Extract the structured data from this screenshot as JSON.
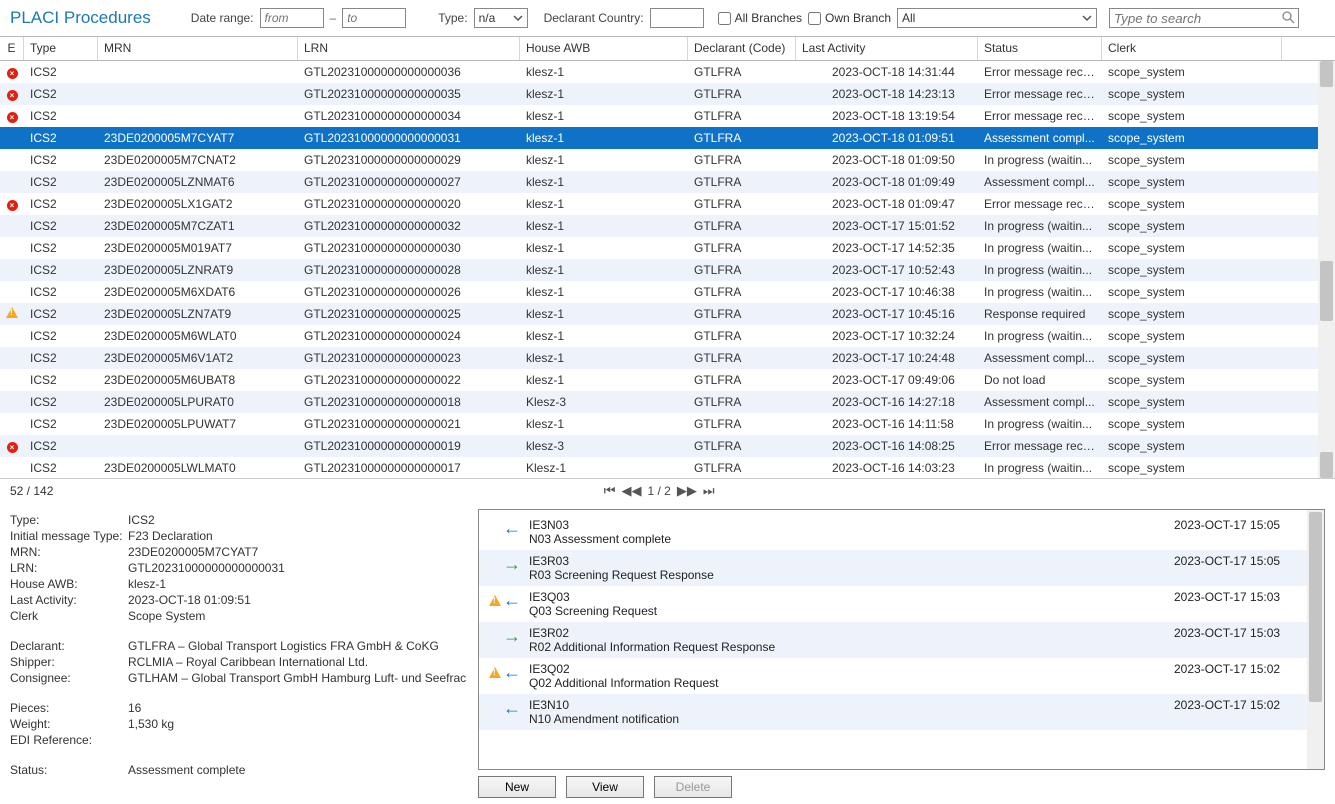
{
  "toolbar": {
    "title": "PLACI Procedures",
    "date_range_label": "Date range:",
    "from_ph": "from",
    "to_ph": "to",
    "sep": "–",
    "type_label": "Type:",
    "type_value": "n/a",
    "decl_country_label": "Declarant Country:",
    "all_branches_label": "All Branches",
    "own_branch_label": "Own Branch",
    "branch_value": "All",
    "search_ph": "Type to search"
  },
  "columns": {
    "e": "E",
    "type": "Type",
    "mrn": "MRN",
    "lrn": "LRN",
    "hawb": "House AWB",
    "decl": "Declarant (Code)",
    "act": "Last Activity",
    "stat": "Status",
    "clerk": "Clerk"
  },
  "rows": [
    {
      "e": "err",
      "type": "ICS2",
      "mrn": "",
      "lrn": "GTL20231000000000000036",
      "hawb": "klesz-1",
      "decl": "GTLFRA",
      "act": "2023-OCT-18 14:31:44",
      "stat": "Error message recei...",
      "clerk": "scope_system"
    },
    {
      "e": "err",
      "type": "ICS2",
      "mrn": "",
      "lrn": "GTL20231000000000000035",
      "hawb": "klesz-1",
      "decl": "GTLFRA",
      "act": "2023-OCT-18 14:23:13",
      "stat": "Error message recei...",
      "clerk": "scope_system"
    },
    {
      "e": "err",
      "type": "ICS2",
      "mrn": "",
      "lrn": "GTL20231000000000000034",
      "hawb": "klesz-1",
      "decl": "GTLFRA",
      "act": "2023-OCT-18 13:19:54",
      "stat": "Error message recei...",
      "clerk": "scope_system"
    },
    {
      "e": "",
      "type": "ICS2",
      "mrn": "23DE0200005M7CYAT7",
      "lrn": "GTL20231000000000000031",
      "hawb": "klesz-1",
      "decl": "GTLFRA",
      "act": "2023-OCT-18 01:09:51",
      "stat": "Assessment compl...",
      "clerk": "scope_system",
      "selected": true
    },
    {
      "e": "",
      "type": "ICS2",
      "mrn": "23DE0200005M7CNAT2",
      "lrn": "GTL20231000000000000029",
      "hawb": "klesz-1",
      "decl": "GTLFRA",
      "act": "2023-OCT-18 01:09:50",
      "stat": "In progress (waitin...",
      "clerk": "scope_system"
    },
    {
      "e": "",
      "type": "ICS2",
      "mrn": "23DE0200005LZNMAT6",
      "lrn": "GTL20231000000000000027",
      "hawb": "klesz-1",
      "decl": "GTLFRA",
      "act": "2023-OCT-18 01:09:49",
      "stat": "Assessment compl...",
      "clerk": "scope_system"
    },
    {
      "e": "err",
      "type": "ICS2",
      "mrn": "23DE0200005LX1GAT2",
      "lrn": "GTL20231000000000000020",
      "hawb": "klesz-1",
      "decl": "GTLFRA",
      "act": "2023-OCT-18 01:09:47",
      "stat": "Error message recei...",
      "clerk": "scope_system"
    },
    {
      "e": "",
      "type": "ICS2",
      "mrn": "23DE0200005M7CZAT1",
      "lrn": "GTL20231000000000000032",
      "hawb": "klesz-1",
      "decl": "GTLFRA",
      "act": "2023-OCT-17 15:01:52",
      "stat": "In progress (waitin...",
      "clerk": "scope_system"
    },
    {
      "e": "",
      "type": "ICS2",
      "mrn": "23DE0200005M019AT7",
      "lrn": "GTL20231000000000000030",
      "hawb": "klesz-1",
      "decl": "GTLFRA",
      "act": "2023-OCT-17 14:52:35",
      "stat": "In progress (waitin...",
      "clerk": "scope_system"
    },
    {
      "e": "",
      "type": "ICS2",
      "mrn": "23DE0200005LZNRAT9",
      "lrn": "GTL20231000000000000028",
      "hawb": "klesz-1",
      "decl": "GTLFRA",
      "act": "2023-OCT-17 10:52:43",
      "stat": "In progress (waitin...",
      "clerk": "scope_system"
    },
    {
      "e": "",
      "type": "ICS2",
      "mrn": "23DE0200005M6XDAT6",
      "lrn": "GTL20231000000000000026",
      "hawb": "klesz-1",
      "decl": "GTLFRA",
      "act": "2023-OCT-17 10:46:38",
      "stat": "In progress (waitin...",
      "clerk": "scope_system"
    },
    {
      "e": "warn",
      "type": "ICS2",
      "mrn": "23DE0200005LZN7AT9",
      "lrn": "GTL20231000000000000025",
      "hawb": "klesz-1",
      "decl": "GTLFRA",
      "act": "2023-OCT-17 10:45:16",
      "stat": "Response required",
      "clerk": "scope_system"
    },
    {
      "e": "",
      "type": "ICS2",
      "mrn": "23DE0200005M6WLAT0",
      "lrn": "GTL20231000000000000024",
      "hawb": "klesz-1",
      "decl": "GTLFRA",
      "act": "2023-OCT-17 10:32:24",
      "stat": "In progress (waitin...",
      "clerk": "scope_system"
    },
    {
      "e": "",
      "type": "ICS2",
      "mrn": "23DE0200005M6V1AT2",
      "lrn": "GTL20231000000000000023",
      "hawb": "klesz-1",
      "decl": "GTLFRA",
      "act": "2023-OCT-17 10:24:48",
      "stat": "Assessment compl...",
      "clerk": "scope_system"
    },
    {
      "e": "",
      "type": "ICS2",
      "mrn": "23DE0200005M6UBAT8",
      "lrn": "GTL20231000000000000022",
      "hawb": "klesz-1",
      "decl": "GTLFRA",
      "act": "2023-OCT-17 09:49:06",
      "stat": "Do not load",
      "clerk": "scope_system"
    },
    {
      "e": "",
      "type": "ICS2",
      "mrn": "23DE0200005LPURAT0",
      "lrn": "GTL20231000000000000018",
      "hawb": "Klesz-3",
      "decl": "GTLFRA",
      "act": "2023-OCT-16 14:27:18",
      "stat": "Assessment compl...",
      "clerk": "scope_system"
    },
    {
      "e": "",
      "type": "ICS2",
      "mrn": "23DE0200005LPUWAT7",
      "lrn": "GTL20231000000000000021",
      "hawb": "klesz-1",
      "decl": "GTLFRA",
      "act": "2023-OCT-16 14:11:58",
      "stat": "In progress (waitin...",
      "clerk": "scope_system"
    },
    {
      "e": "err",
      "type": "ICS2",
      "mrn": "",
      "lrn": "GTL20231000000000000019",
      "hawb": "klesz-3",
      "decl": "GTLFRA",
      "act": "2023-OCT-16 14:08:25",
      "stat": "Error message recei...",
      "clerk": "scope_system"
    },
    {
      "e": "",
      "type": "ICS2",
      "mrn": "23DE0200005LWLMAT0",
      "lrn": "GTL20231000000000000017",
      "hawb": "Klesz-1",
      "decl": "GTLFRA",
      "act": "2023-OCT-16 14:03:23",
      "stat": "In progress (waitin...",
      "clerk": "scope_system"
    }
  ],
  "pager": {
    "count": "52 / 142",
    "page": "1 / 2"
  },
  "details": {
    "type_l": "Type:",
    "type_v": "ICS2",
    "imt_l": "Initial message Type:",
    "imt_v": "F23 Declaration",
    "mrn_l": "MRN:",
    "mrn_v": "23DE0200005M7CYAT7",
    "lrn_l": "LRN:",
    "lrn_v": "GTL20231000000000000031",
    "hawb_l": "House AWB:",
    "hawb_v": "klesz-1",
    "act_l": "Last Activity:",
    "act_v": "2023-OCT-18 01:09:51",
    "clerk_l": "Clerk",
    "clerk_v": "Scope System",
    "decl_l": "Declarant:",
    "decl_v": "GTLFRA – Global Transport Logistics FRA GmbH & CoKG",
    "ship_l": "Shipper:",
    "ship_v": "RCLMIA – Royal Caribbean International Ltd.",
    "cons_l": "Consignee:",
    "cons_v": "GTLHAM – Global Transport GmbH Hamburg Luft- und Seefrac",
    "pcs_l": "Pieces:",
    "pcs_v": "16",
    "wt_l": "Weight:",
    "wt_v": "1,530 kg",
    "edi_l": "EDI Reference:",
    "edi_v": "",
    "stat_l": "Status:",
    "stat_v": "Assessment complete"
  },
  "messages": [
    {
      "ic": "in",
      "warn": false,
      "code": "IE3N03",
      "desc": "N03 Assessment complete",
      "date": "2023-OCT-17 15:05"
    },
    {
      "ic": "out",
      "warn": false,
      "code": "IE3R03",
      "desc": "R03 Screening Request Response",
      "date": "2023-OCT-17 15:05"
    },
    {
      "ic": "in",
      "warn": true,
      "code": "IE3Q03",
      "desc": "Q03 Screening Request",
      "date": "2023-OCT-17 15:03"
    },
    {
      "ic": "out",
      "warn": false,
      "code": "IE3R02",
      "desc": "R02 Additional Information Request Response",
      "date": "2023-OCT-17 15:03"
    },
    {
      "ic": "in",
      "warn": true,
      "code": "IE3Q02",
      "desc": "Q02 Additional Information Request",
      "date": "2023-OCT-17 15:02"
    },
    {
      "ic": "in",
      "warn": false,
      "code": "IE3N10",
      "desc": "N10 Amendment notification",
      "date": "2023-OCT-17 15:02"
    }
  ],
  "buttons": {
    "new": "New",
    "view": "View",
    "delete": "Delete"
  }
}
